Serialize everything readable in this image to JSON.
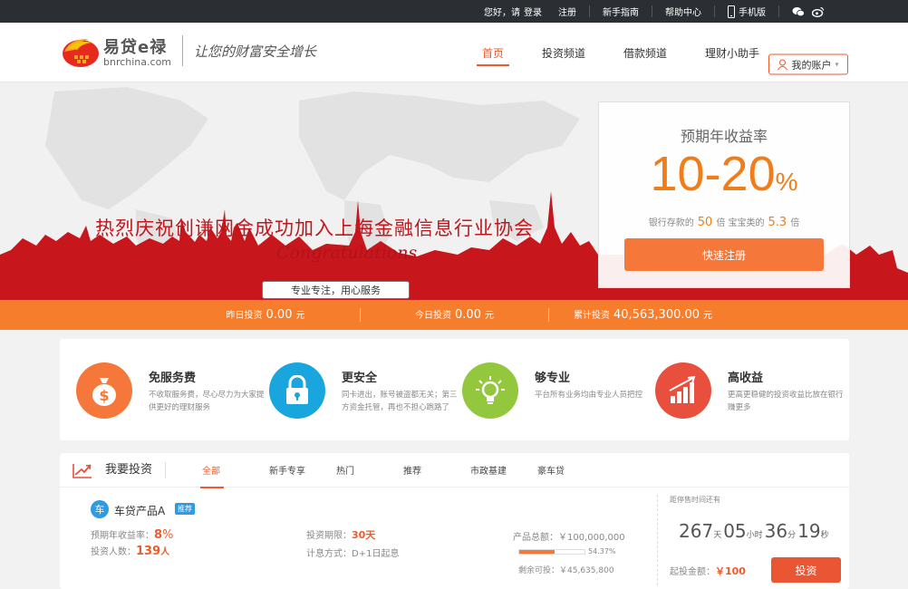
{
  "topbar": {
    "greeting": "您好，请",
    "login": "登录",
    "register": "注册",
    "guide": "新手指南",
    "help": "帮助中心",
    "mobile": "手机版",
    "icons": [
      "phone-icon",
      "wechat-icon",
      "weibo-icon"
    ]
  },
  "header": {
    "logo_name": "易贷e禄",
    "logo_url": "bnrchina.com",
    "slogan": "让您的财富安全增长",
    "nav": [
      "首页",
      "投资频道",
      "借款频道",
      "理财小助手"
    ],
    "account": "我的账户"
  },
  "banner": {
    "title": "热烈庆祝创谦网金成功加入上海金融信息行业协会",
    "congrats": "Congratulations",
    "tagline": "专业专注，用心服务",
    "yield_label": "预期年收益率",
    "yield_value": "10-20",
    "yield_unit": "%",
    "compare_prefix": "银行存款的",
    "compare_bank": "50",
    "compare_mid": "倍 宝宝类的",
    "compare_baobao": "5.3",
    "compare_suffix": "倍",
    "register_button": "快速注册",
    "colors": {
      "red": "#c0161d",
      "orange": "#f57d2b"
    }
  },
  "stats": [
    {
      "label": "昨日投资",
      "value": "0.00",
      "unit": "元"
    },
    {
      "label": "今日投资",
      "value": "0.00",
      "unit": "元"
    },
    {
      "label": "累计投资",
      "value": "40,563,300.00",
      "unit": "元"
    }
  ],
  "features": [
    {
      "title": "免服务费",
      "desc": "不收取服务费，尽心尽力为大家提供更好的理财服务",
      "icon": "money-bag-icon",
      "color": "#f5783a"
    },
    {
      "title": "更安全",
      "desc": "同卡进出，账号被盗都无关；第三方资金托管，再也不担心跑路了",
      "icon": "lock-icon",
      "color": "#19a6de"
    },
    {
      "title": "够专业",
      "desc": "平台所有业务均由专业人员把控",
      "icon": "lightbulb-icon",
      "color": "#93c83e"
    },
    {
      "title": "高收益",
      "desc": "更高更稳健的投资收益比放在银行赚更多",
      "icon": "bar-chart-icon",
      "color": "#e84f3d"
    }
  ],
  "invest": {
    "title": "我要投资",
    "tabs": [
      "全部",
      "新手专享",
      "热门",
      "推荐",
      "市政基建",
      "豪车贷"
    ],
    "product": {
      "badge": "车",
      "name": "车贷产品A",
      "tag": "推荐",
      "rate_label": "预期年收益率：",
      "rate": "8",
      "rate_unit": "%",
      "investors_label": "投资人数：",
      "investors": "139",
      "investors_unit": "人",
      "term_label": "投资期限：",
      "term": "30天",
      "method_label": "计息方式：",
      "method": "D+1日起息",
      "total_label": "产品总额：",
      "total": "￥100,000,000",
      "progress": 54.37,
      "progress_text": "54.37%",
      "remain_label": "剩余可投：",
      "remain": "￥45,635,800",
      "countdown_label": "距停售时间还有",
      "countdown": {
        "days": "267",
        "d_unit": "天",
        "hours": "05",
        "h_unit": "小时",
        "minutes": "36",
        "m_unit": "分",
        "seconds": "19",
        "s_unit": "秒"
      },
      "min_label": "起投金额：",
      "min": "￥100",
      "buy_button": "投资"
    }
  }
}
